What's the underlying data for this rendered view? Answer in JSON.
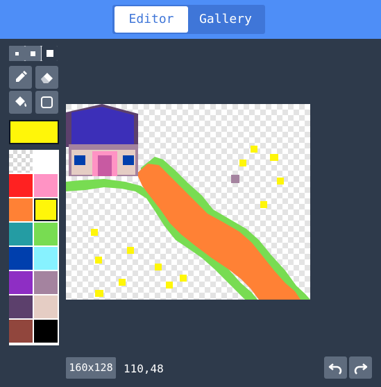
{
  "header": {
    "tabs": [
      {
        "label": "Editor",
        "active": true
      },
      {
        "label": "Gallery",
        "active": false
      }
    ]
  },
  "tools": {
    "sizes": [
      "small",
      "medium",
      "large"
    ],
    "selected_size": "large",
    "items": [
      {
        "name": "pencil",
        "icon": "pencil-icon"
      },
      {
        "name": "eraser",
        "icon": "eraser-icon"
      },
      {
        "name": "fill",
        "icon": "paint-bucket-icon"
      },
      {
        "name": "rectangle",
        "icon": "rectangle-icon"
      }
    ]
  },
  "current_color": "#fff609",
  "palette": [
    "transparent",
    "#ffffff",
    "#ff2121",
    "#ff93c4",
    "#ff8135",
    "#fff609",
    "#249ca3",
    "#78dc52",
    "#003fad",
    "#87f2ff",
    "#8e2ec4",
    "#a4839f",
    "#5c406c",
    "#e5cdc4",
    "#91463d",
    "#000000"
  ],
  "selected_palette_index": 5,
  "canvas": {
    "resolution": "160x128",
    "cursor": "110,48"
  },
  "history": {
    "undo_icon": "undo-icon",
    "redo_icon": "redo-icon"
  }
}
